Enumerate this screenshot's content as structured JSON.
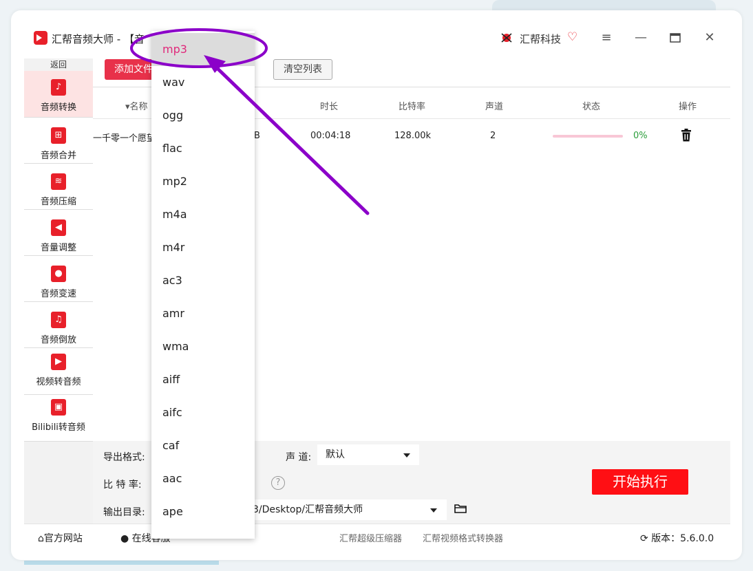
{
  "window": {
    "title": "汇帮音频大师 - 【音",
    "brand": "汇帮科技"
  },
  "sidebar": {
    "back": "返回",
    "items": [
      {
        "label": "音频转换",
        "icon": "audio-convert-icon"
      },
      {
        "label": "音频合并",
        "icon": "audio-merge-icon"
      },
      {
        "label": "音频压缩",
        "icon": "audio-compress-icon"
      },
      {
        "label": "音量调整",
        "icon": "volume-adjust-icon"
      },
      {
        "label": "音频变速",
        "icon": "audio-speed-icon"
      },
      {
        "label": "音频倒放",
        "icon": "audio-reverse-icon"
      },
      {
        "label": "视频转音频",
        "icon": "video-to-audio-icon"
      },
      {
        "label": "Bilibili转音频",
        "icon": "bilibili-icon"
      }
    ]
  },
  "toolbar": {
    "add_file": "添加文件",
    "clear_list": "清空列表"
  },
  "table": {
    "columns": {
      "name": "名称",
      "duration": "时长",
      "bitrate": "比特率",
      "channels": "声道",
      "status": "状态",
      "action": "操作"
    },
    "rows": [
      {
        "name": "一千零一个愿望",
        "size_tail": "B",
        "duration": "00:04:18",
        "bitrate": "128.00k",
        "channels": "2",
        "progress": 0,
        "progress_text": "0%"
      }
    ]
  },
  "settings": {
    "format_label": "导出格式:",
    "channel_label": "声 道:",
    "channel_value": "默认",
    "bitrate_label": "比 特 率:",
    "output_label": "输出目录:",
    "output_path": "3/Desktop/汇帮音频大师",
    "start_button": "开始执行"
  },
  "footer": {
    "website": "官方网站",
    "online": "在线客服",
    "link1": "汇帮超级压缩器",
    "link2": "汇帮视频格式转换器",
    "version": "版本：5.6.0.0"
  },
  "format_dropdown": {
    "selected": "mp3",
    "options": [
      "mp3",
      "wav",
      "ogg",
      "flac",
      "mp2",
      "m4a",
      "m4r",
      "ac3",
      "amr",
      "wma",
      "aiff",
      "aifc",
      "caf",
      "aac",
      "ape"
    ]
  },
  "colors": {
    "accent": "#e8202a",
    "annotation": "#8b00c9",
    "selected_text": "#e0287a"
  }
}
